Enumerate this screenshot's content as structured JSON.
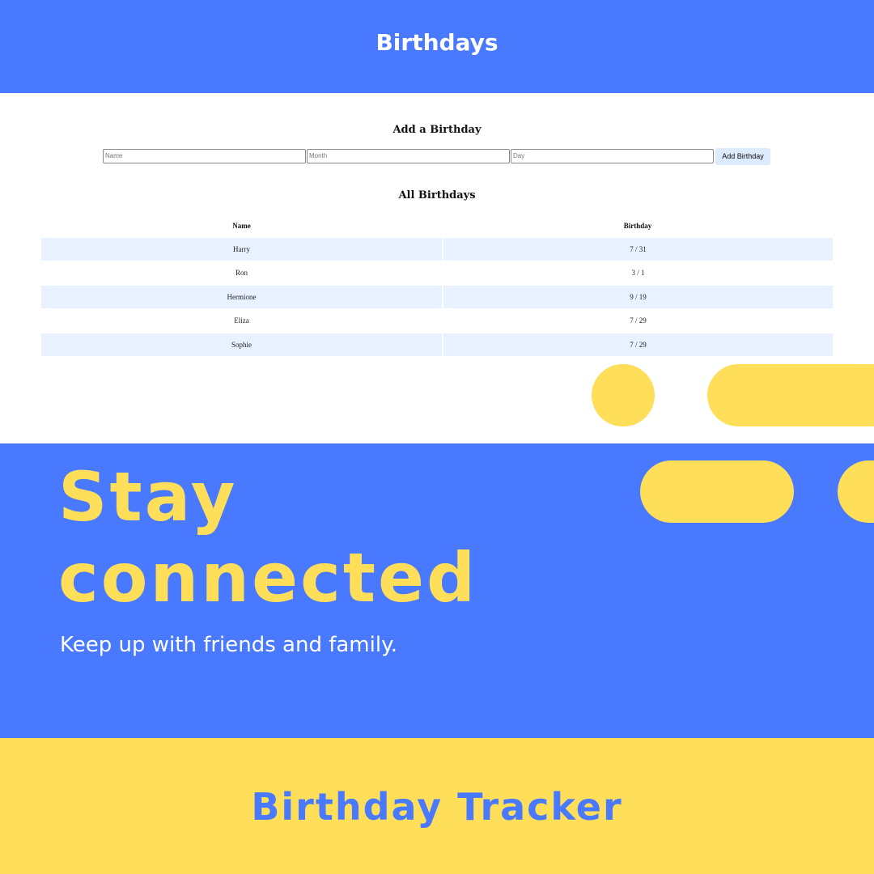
{
  "header": {
    "title": "Birthdays"
  },
  "add_section": {
    "heading": "Add a Birthday",
    "name_placeholder": "Name",
    "month_placeholder": "Month",
    "day_placeholder": "Day",
    "button_label": "Add Birthday"
  },
  "list_section": {
    "heading": "All Birthdays",
    "columns": [
      "Name",
      "Birthday"
    ],
    "rows": [
      {
        "name": "Harry",
        "birthday": "7 / 31"
      },
      {
        "name": "Ron",
        "birthday": "3 / 1"
      },
      {
        "name": "Hermione",
        "birthday": "9 / 19"
      },
      {
        "name": "Eliza",
        "birthday": "7 / 29"
      },
      {
        "name": "Sophie",
        "birthday": "7 / 29"
      }
    ]
  },
  "promo": {
    "headline_line1": "Stay",
    "headline_line2": "connected",
    "tagline": "Keep up with friends and family."
  },
  "footer": {
    "title": "Birthday Tracker"
  },
  "colors": {
    "brand_blue": "#4879FE",
    "accent_yellow": "#FFDE59",
    "row_shade": "#E8F1FF",
    "button_bg": "#DDEBFF"
  }
}
